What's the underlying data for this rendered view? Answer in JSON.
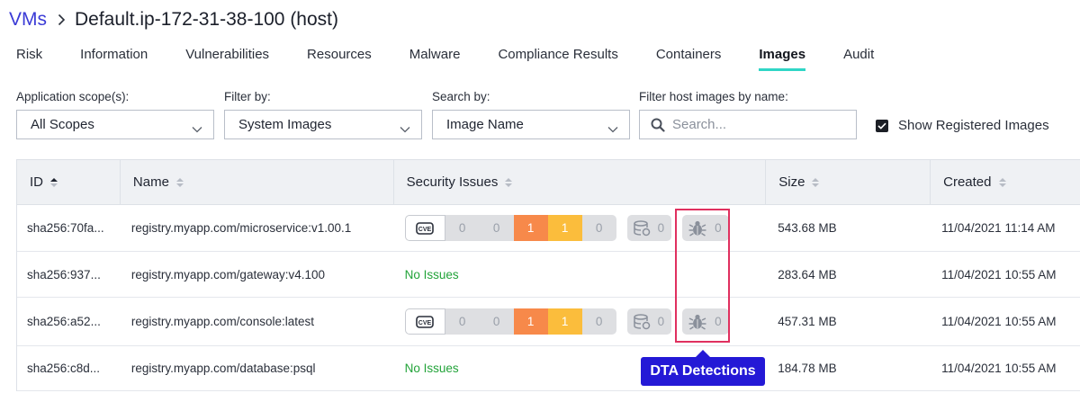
{
  "breadcrumb": {
    "parent": "VMs",
    "title": "Default.ip-172-31-38-100 (host)"
  },
  "tabs": [
    {
      "label": "Risk",
      "active": false
    },
    {
      "label": "Information",
      "active": false
    },
    {
      "label": "Vulnerabilities",
      "active": false
    },
    {
      "label": "Resources",
      "active": false
    },
    {
      "label": "Malware",
      "active": false
    },
    {
      "label": "Compliance Results",
      "active": false
    },
    {
      "label": "Containers",
      "active": false
    },
    {
      "label": "Images",
      "active": true
    },
    {
      "label": "Audit",
      "active": false
    }
  ],
  "filters": {
    "scope": {
      "label": "Application scope(s):",
      "value": "All Scopes"
    },
    "filter_by": {
      "label": "Filter by:",
      "value": "System Images"
    },
    "search_by": {
      "label": "Search by:",
      "value": "Image Name"
    },
    "name_filter": {
      "label": "Filter host images by name:",
      "placeholder": "Search..."
    },
    "show_registered": {
      "label": "Show Registered Images",
      "checked": true
    }
  },
  "table": {
    "columns": [
      "ID",
      "Name",
      "Security Issues",
      "Size",
      "Created"
    ],
    "rows": [
      {
        "id": "sha256:70fa...",
        "name": "registry.myapp.com/microservice:v1.00.1",
        "no_issues": "",
        "cve": [
          "0",
          "0",
          "1",
          "1",
          "0"
        ],
        "db": "0",
        "dta": "0",
        "size": "543.68 MB",
        "created": "11/04/2021 11:14 AM"
      },
      {
        "id": "sha256:937...",
        "name": "registry.myapp.com/gateway:v4.100",
        "no_issues": "No Issues",
        "size": "283.64 MB",
        "created": "11/04/2021 10:55 AM"
      },
      {
        "id": "sha256:a52...",
        "name": "registry.myapp.com/console:latest",
        "no_issues": "",
        "cve": [
          "0",
          "0",
          "1",
          "1",
          "0"
        ],
        "db": "0",
        "dta": "0",
        "size": "457.31 MB",
        "created": "11/04/2021 10:55 AM"
      },
      {
        "id": "sha256:c8d...",
        "name": "registry.myapp.com/database:psql",
        "no_issues": "No Issues",
        "size": "184.78 MB",
        "created": "11/04/2021 10:55 AM"
      }
    ]
  },
  "callout": {
    "label": "DTA Detections"
  },
  "colors": {
    "accent": "#3b3bd6",
    "tab_underline": "#2fd6c6",
    "high": "#f7894a",
    "medium": "#fbbd3c",
    "ok": "#22a339",
    "callout": "#2419d6",
    "highlight": "#e0305f"
  },
  "icons": [
    "chevron-right-icon",
    "chevron-down-icon",
    "search-icon",
    "checkmark-icon",
    "sort-asc-icon",
    "sort-icon",
    "cve-icon",
    "database-icon",
    "bug-icon"
  ]
}
